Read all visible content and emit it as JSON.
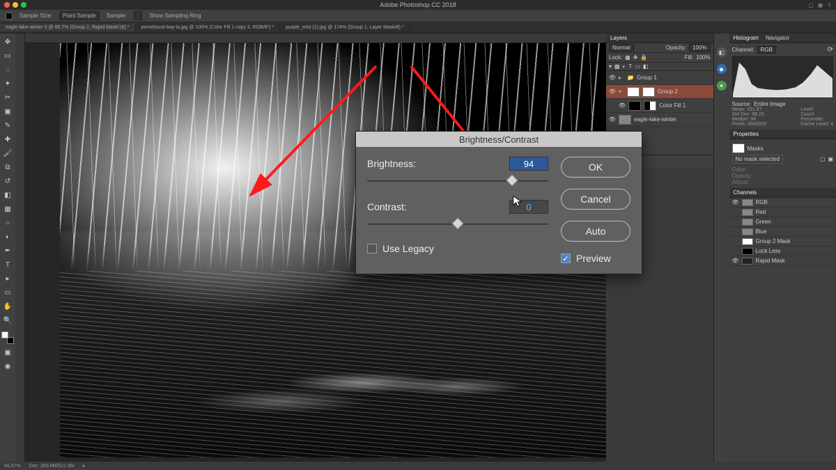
{
  "app": {
    "title": "Adobe Photoshop CC 2018"
  },
  "optionsBar": {
    "sampleSizeLabel": "Sample Size:",
    "sampleSizeValue": "Point Sample",
    "sampleLabel": "Sample:",
    "showRingLabel": "Show Sampling Ring"
  },
  "docTabs": [
    "eagle-lake-winter-3 @ 66.7% (Group 2, Rapid Mask/16) *",
    "pemebscot-bay-la.jpg @ 100% (Color Fill 1 copy 3, RGB/8*) *",
    "purple_mist (1).jpg @ 174% (Group 1, Layer Mask/8) *"
  ],
  "activeDocTab": 0,
  "dialog": {
    "title": "Brightness/Contrast",
    "brightnessLabel": "Brightness:",
    "brightnessValue": "94",
    "brightnessPosPct": 80,
    "contrastLabel": "Contrast:",
    "contrastValue": "0",
    "contrastPosPct": 50,
    "okLabel": "OK",
    "cancelLabel": "Cancel",
    "autoLabel": "Auto",
    "useLegacyLabel": "Use Legacy",
    "useLegacyChecked": false,
    "previewLabel": "Preview",
    "previewChecked": true
  },
  "panels": {
    "layersTab": "Layers",
    "channelsTab": "Channels",
    "histogramTab": "Histogram",
    "navigatorTab": "Navigator",
    "propertiesTab": "Properties",
    "blendMode": "Normal",
    "opacityLabel": "Opacity:",
    "opacityValue": "100%",
    "lockLabel": "Lock:",
    "fillLabel": "Fill:",
    "fillValue": "100%",
    "layers": [
      {
        "name": "Group 1",
        "kind": "group"
      },
      {
        "name": "Group 2",
        "kind": "group-sel"
      },
      {
        "name": "Color Fill 1",
        "kind": "adj"
      },
      {
        "name": "eagle-lake-winter",
        "kind": "img"
      }
    ],
    "histogram": {
      "channelLabel": "Channel:",
      "channelValue": "RGB",
      "sourceLabel": "Source:",
      "sourceValue": "Entire Image",
      "stats": {
        "meanL": "Mean:",
        "meanV": "151.97",
        "stdL": "Std Dev:",
        "stdV": "98.23",
        "medL": "Median:",
        "medV": "94",
        "pxL": "Pixels:",
        "pxV": "4583000",
        "lvlL": "Level:",
        "lvlV": "",
        "cntL": "Count:",
        "cntV": "",
        "pctL": "Percentile:",
        "pctV": "",
        "cacheL": "Cache Level:",
        "cacheV": "4"
      }
    },
    "properties": {
      "masksLabel": "Masks",
      "noMaskLabel": "No mask selected",
      "colorLabel": "Color:",
      "opacityLabel": "Opacity:",
      "adjustLabel": "Adjust:"
    },
    "channels": [
      "RGB",
      "Red",
      "Green",
      "Blue",
      "Group 2 Mask",
      "Lock Less",
      "Rapid Mask"
    ]
  },
  "status": {
    "zoom": "66.67%",
    "docinfo": "Doc: 283.8M/521.9M"
  },
  "chart_data": {
    "type": "area",
    "title": "Histogram",
    "xlabel": "",
    "ylabel": "",
    "xlim": [
      0,
      255
    ],
    "x": [
      0,
      20,
      40,
      60,
      80,
      100,
      120,
      140,
      160,
      180,
      200,
      220,
      240,
      255
    ],
    "values": [
      10,
      95,
      70,
      35,
      25,
      22,
      20,
      22,
      28,
      40,
      60,
      85,
      70,
      50
    ]
  }
}
